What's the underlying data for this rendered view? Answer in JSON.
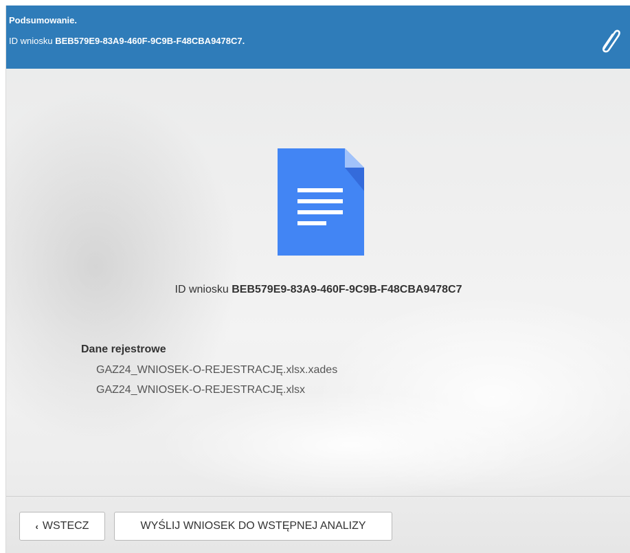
{
  "header": {
    "title": "Podsumowanie.",
    "id_prefix": "ID wniosku",
    "id_value": "BEB579E9-83A9-460F-9C9B-F48CBA9478C7.",
    "attach_icon": "paperclip-icon"
  },
  "main": {
    "doc_icon": "document-icon",
    "id_prefix": "ID wniosku",
    "id_value": "BEB579E9-83A9-460F-9C9B-F48CBA9478C7",
    "registry_title": "Dane rejestrowe",
    "files": [
      "GAZ24_WNIOSEK-O-REJESTRACJĘ.xlsx.xades",
      "GAZ24_WNIOSEK-O-REJESTRACJĘ.xlsx"
    ]
  },
  "footer": {
    "back_chevron": "‹",
    "back_label": "WSTECZ",
    "send_label": "WYŚLIJ WNIOSEK DO WSTĘPNEJ ANALIZY"
  },
  "colors": {
    "header_bg": "#2f7cb9",
    "doc_blue": "#4285f4",
    "doc_fold": "#a1c2fa",
    "doc_shadow": "#2a56c6"
  }
}
